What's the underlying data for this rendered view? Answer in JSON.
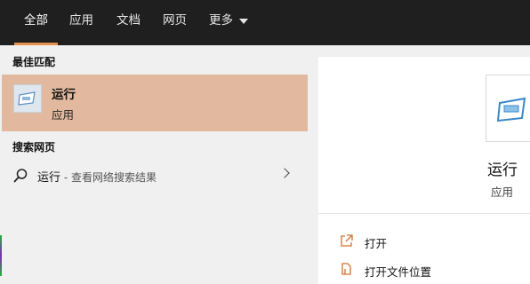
{
  "tabs": [
    {
      "label": "全部"
    },
    {
      "label": "应用"
    },
    {
      "label": "文档"
    },
    {
      "label": "网页"
    },
    {
      "label": "更多"
    }
  ],
  "best_match": {
    "heading": "最佳匹配",
    "title": "运行",
    "subtitle": "应用",
    "icon": "run-app-icon"
  },
  "web_search": {
    "heading": "搜索网页",
    "query": "运行",
    "hint": " - 查看网络搜索结果",
    "icon": "search-icon"
  },
  "detail": {
    "title": "运行",
    "subtitle": "应用",
    "icon": "run-app-icon",
    "actions": [
      {
        "label": "打开",
        "icon": "open-icon"
      },
      {
        "label": "打开文件位置",
        "icon": "file-location-icon"
      }
    ]
  },
  "colors": {
    "accent": "#e4904f",
    "selected_bg": "#e2b99e",
    "topbar_bg": "#1f1f1f"
  }
}
